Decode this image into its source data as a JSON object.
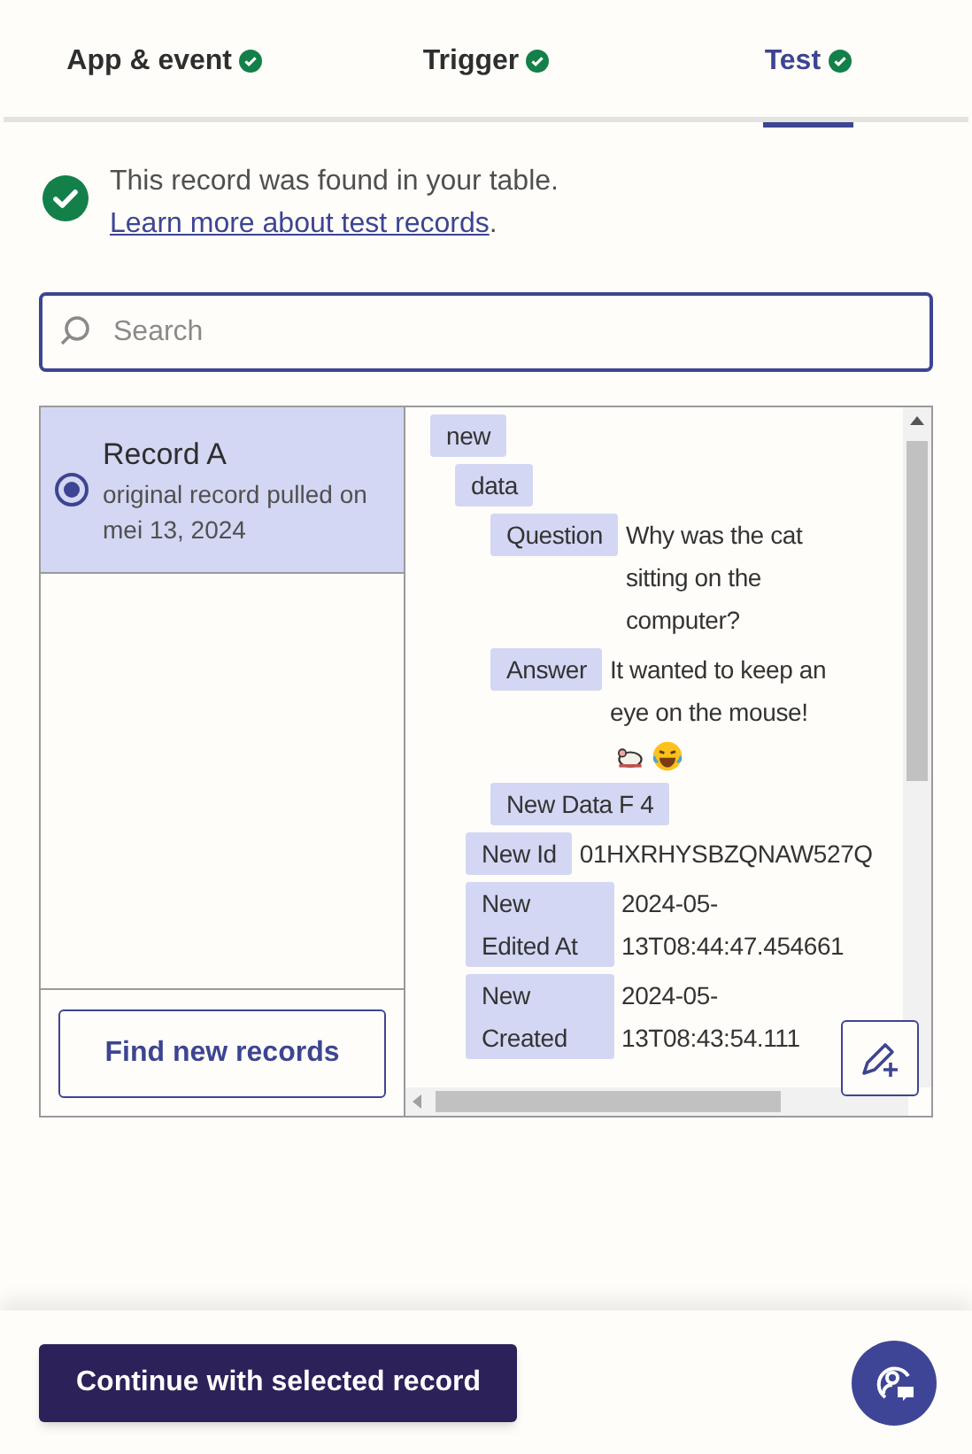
{
  "tabs": [
    {
      "label": "App & event",
      "complete": true,
      "selected": false
    },
    {
      "label": "Trigger",
      "complete": true,
      "selected": false
    },
    {
      "label": "Test",
      "complete": true,
      "selected": true
    }
  ],
  "notice": {
    "text": "This record was found in your table.",
    "link": "Learn more about test records",
    "after": "."
  },
  "search": {
    "placeholder": "Search"
  },
  "records": [
    {
      "title": "Record A",
      "subtitle": "original record pulled on mei 13, 2024",
      "selected": true
    }
  ],
  "find_button": "Find new records",
  "tree": [
    {
      "key": "new",
      "children": [
        {
          "key": "data",
          "children": [
            {
              "key": "Question",
              "value": "Why was the cat sitting on the computer?"
            },
            {
              "key": "Answer",
              "value": "It wanted to keep an eye on the mouse!",
              "trailing_icons": true
            },
            {
              "key": "New Data F 4"
            }
          ]
        },
        {
          "key": "New Id",
          "value": "01HXRHYSBZQNAW527Q"
        },
        {
          "key": "New Edited At",
          "value": "2024-05-13T08:44:47.454661"
        },
        {
          "key": "New Created",
          "value": "2024-05-13T08:43:54.111"
        }
      ]
    }
  ],
  "continue_button": "Continue with selected record"
}
